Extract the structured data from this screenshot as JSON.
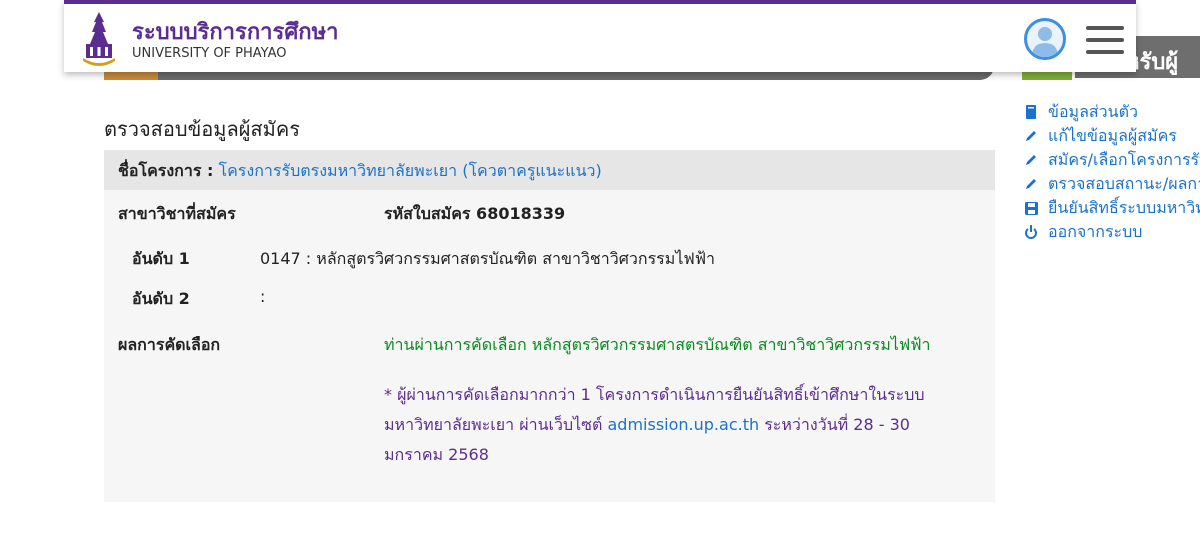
{
  "header": {
    "brand_th": "ระบบบริการการศึกษา",
    "brand_en": "UNIVERSITY OF PHAYAO",
    "side_tab_text": "หรับผู้"
  },
  "page": {
    "title": "ตรวจสอบข้อมูลผู้สมัคร"
  },
  "project": {
    "label": "ชื่อโครงการ :",
    "name": "โครงการรับตรงมหาวิทยาลัยพะเยา (โควตาครูแนะแนว)"
  },
  "application": {
    "major_label": "สาขาวิชาที่สมัคร",
    "app_no_label": "รหัสใบสมัคร 68018339",
    "rank1_label": "อันดับ 1",
    "rank1_value": "0147 : หลักสูตรวิศวกรรมศาสตรบัณฑิต สาขาวิชาวิศวกรรมไฟฟ้า",
    "rank2_label": "อันดับ 2",
    "rank2_value": ":",
    "result_label": "ผลการคัดเลือก",
    "result_value": "ท่านผ่านการคัดเลือก หลักสูตรวิศวกรรมศาสตรบัณฑิต สาขาวิชาวิศวกรรมไฟฟ้า",
    "note_part1": "* ผู้ผ่านการคัดเลือกมากกว่า 1 โครงการดำเนินการยืนยันสิทธิ์เข้าศึกษาในระบบมหาวิทยาลัยพะเยา ผ่านเว็บไซต์ ",
    "note_link": "admission.up.ac.th",
    "note_part2": " ระหว่างวันที่ 28 - 30 มกราคม 2568"
  },
  "sidebar": {
    "items": [
      {
        "label": "ข้อมูลส่วนตัว",
        "icon": "book-icon"
      },
      {
        "label": "แก้ไขข้อมูลผู้สมัคร",
        "icon": "pencil-icon"
      },
      {
        "label": "สมัคร/เลือกโครงการรับ",
        "icon": "pencil-icon"
      },
      {
        "label": "ตรวจสอบสถานะ/ผลการ",
        "icon": "pencil-icon"
      },
      {
        "label": "ยืนยันสิทธิ์ระบบมหาวิทยาลัย",
        "icon": "floppy-icon"
      },
      {
        "label": "ออกจากระบบ",
        "icon": "power-icon"
      }
    ]
  },
  "colors": {
    "brand": "#5c2d91",
    "link": "#1a73c8",
    "success": "#0a8a1e"
  }
}
